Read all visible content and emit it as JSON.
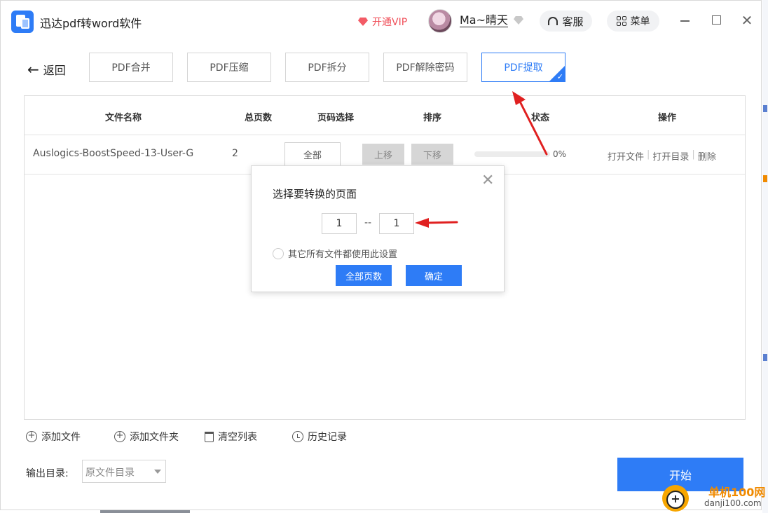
{
  "app": {
    "title": "迅达pdf转word软件"
  },
  "header": {
    "vip_label": "开通VIP",
    "username": "Ma~晴天",
    "service_label": "客服",
    "menu_label": "菜单"
  },
  "toolbar": {
    "back_label": "返回",
    "tools": [
      "PDF合并",
      "PDF压缩",
      "PDF拆分",
      "PDF解除密码",
      "PDF提取"
    ],
    "active_tool": "PDF提取"
  },
  "table": {
    "columns": [
      "文件名称",
      "总页数",
      "页码选择",
      "排序",
      "状态",
      "操作"
    ],
    "rows": [
      {
        "file_name": "Auslogics-BoostSpeed-13-User-Gu",
        "total_pages": "2",
        "page_select": "全部",
        "move_up": "上移",
        "move_down": "下移",
        "progress": 0,
        "status": "0%",
        "actions": [
          "打开文件",
          "打开目录",
          "删除"
        ]
      }
    ]
  },
  "bottom": {
    "add_file": "添加文件",
    "add_folder": "添加文件夹",
    "clear_list": "清空列表",
    "history": "历史记录",
    "output_label": "输出目录:",
    "output_value": "原文件目录",
    "start_label": "开始"
  },
  "dialog": {
    "title": "选择要转换的页面",
    "from_page": "1",
    "separator": "--",
    "to_page": "1",
    "apply_all": "其它所有文件都使用此设置",
    "all_pages_button": "全部页数",
    "confirm_button": "确定"
  },
  "watermark": {
    "brand": "单机100网",
    "url": "danji100.com"
  },
  "colors": {
    "accent": "#2e7cf6",
    "vip": "#f0505a",
    "annotation": "#e02020"
  }
}
